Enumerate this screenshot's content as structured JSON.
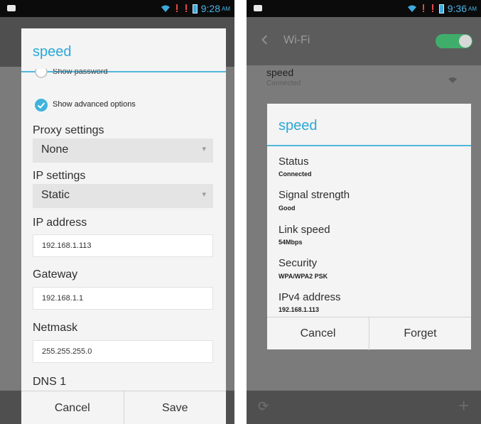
{
  "left": {
    "status": {
      "time": "9:28",
      "ampm": "AM"
    },
    "dialog": {
      "title": "speed",
      "show_password": "Show password",
      "show_advanced": "Show advanced options",
      "proxy_label": "Proxy settings",
      "proxy_value": "None",
      "ip_settings_label": "IP settings",
      "ip_settings_value": "Static",
      "ip_address_label": "IP address",
      "ip_address_value": "192.168.1.113",
      "gateway_label": "Gateway",
      "gateway_value": "192.168.1.1",
      "netmask_label": "Netmask",
      "netmask_value": "255.255.255.0",
      "dns1_label": "DNS 1",
      "cancel": "Cancel",
      "save": "Save"
    }
  },
  "right": {
    "status": {
      "time": "9:36",
      "ampm": "AM"
    },
    "actionbar": {
      "title": "Wi-Fi",
      "back_icon": "chevron-left-icon",
      "toggle_state": "on"
    },
    "network": {
      "name": "speed",
      "status": "Connected"
    },
    "dialog": {
      "title": "speed",
      "rows": [
        {
          "label": "Status",
          "value": "Connected"
        },
        {
          "label": "Signal strength",
          "value": "Good"
        },
        {
          "label": "Link speed",
          "value": "54Mbps"
        },
        {
          "label": "Security",
          "value": "WPA/WPA2 PSK"
        },
        {
          "label": "IPv4 address",
          "value": "192.168.1.113"
        }
      ],
      "cancel": "Cancel",
      "forget": "Forget"
    },
    "bottom": {
      "add_icon": "+"
    }
  },
  "colors": {
    "accent": "#2aa8d8",
    "divider": "#4fb7dd",
    "toggle": "#3fae6b"
  }
}
